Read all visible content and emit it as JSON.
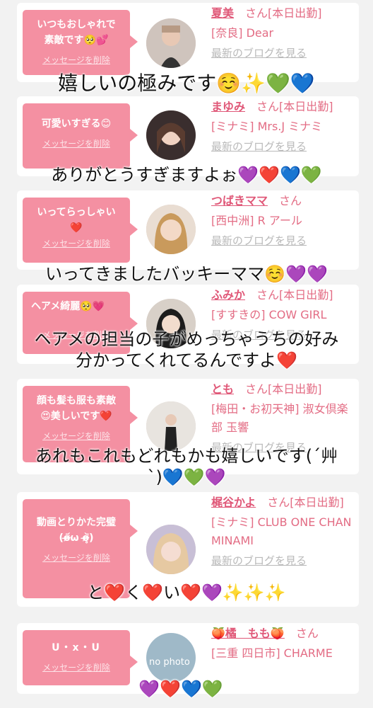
{
  "colors": {
    "bubble": "#f490a2",
    "name": "#e05878",
    "text": "#e36c84",
    "muted": "#b9b9b9",
    "bg": "#f2f2f2"
  },
  "cards": [
    {
      "message": "いつもおしゃれで\n素敵です🥺💕",
      "delete_label": "メッセージを削除",
      "name": "夏美",
      "suffix": "さん[本日出勤]",
      "shop": "[奈良] Dear",
      "blog_label": "最新のブログを見る",
      "caption": "嬉しいの極みです☺️✨💚💙"
    },
    {
      "message": "可愛いすぎる😊",
      "delete_label": "メッセージを削除",
      "name": "まゆみ",
      "suffix": "さん[本日出勤]",
      "shop": "[ミナミ] Mrs.J ミナミ",
      "blog_label": "最新のブログを見る",
      "caption": "ありがとうすぎますよぉ💜❤️💙💚"
    },
    {
      "message": "いってらっしゃい\n❤️",
      "delete_label": "メッセージを削除",
      "name": "つばきママ",
      "suffix": "さん",
      "shop": "[西中洲] R アール",
      "blog_label": "最新のブログを見る",
      "caption": "いってきましたバッキーママ☺️💜💜"
    },
    {
      "message": "ヘアメ綺麗🥺💗",
      "delete_label": "メッセージを削除",
      "name": "ふみか",
      "suffix": "さん[本日出勤]",
      "shop": "[すすきの] COW GIRL",
      "blog_label": "最新のブログを見る",
      "caption": "ヘアメの担当の子がめっちゃうちの好み\n分かってくれてるんですよ❤️"
    },
    {
      "message": "顔も髪も服も素敵\n😍美しいです❤️",
      "delete_label": "メッセージを削除",
      "name": "とも",
      "suffix": "さん[本日出勤]",
      "shop": "[梅田・お初天神] 淑女倶楽部 玉響",
      "blog_label": "最新のブログを見る",
      "caption": "あれもこれもどれもかも嬉しいです(´艸\n`)💙💚💜"
    },
    {
      "message": "動画とりかた完璧\n(o̴̶̷᷄ω o̴̶̷̥᷅)",
      "delete_label": "メッセージを削除",
      "name": "梶谷かよ",
      "suffix": "さん[本日出勤]",
      "shop": "[ミナミ] CLUB ONE CHAN MINAMI",
      "blog_label": "最新のブログを見る",
      "caption": "と❤️く❤️い❤️💜✨✨✨"
    },
    {
      "message": "U・x・U",
      "delete_label": "メッセージを削除",
      "name": "🍑橘　もも🍑",
      "suffix": "さん",
      "shop": "[三重 四日市] CHARME",
      "blog_label": "",
      "caption": "💜❤️💙💚",
      "avatar_text": "no photo"
    }
  ]
}
